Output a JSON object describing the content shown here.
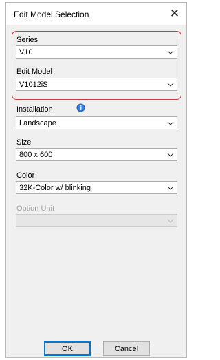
{
  "dialog": {
    "title": "Edit Model Selection",
    "close_glyph": "✕"
  },
  "fields": {
    "series": {
      "label": "Series",
      "value": "V10"
    },
    "edit_model": {
      "label": "Edit Model",
      "value": "V1012iS"
    },
    "installation": {
      "label": "Installation",
      "value": "Landscape"
    },
    "size": {
      "label": "Size",
      "value": "800 x 600"
    },
    "color": {
      "label": "Color",
      "value": "32K-Color w/  blinking"
    },
    "option_unit": {
      "label": "Option Unit",
      "value": ""
    }
  },
  "buttons": {
    "ok": "OK",
    "cancel": "Cancel"
  },
  "icons": {
    "info": "info-icon",
    "dropdown": "chevron-down-icon"
  },
  "colors": {
    "highlight": "#e0323a",
    "focus": "#0078d7",
    "info_blue": "#1a5fb4"
  }
}
